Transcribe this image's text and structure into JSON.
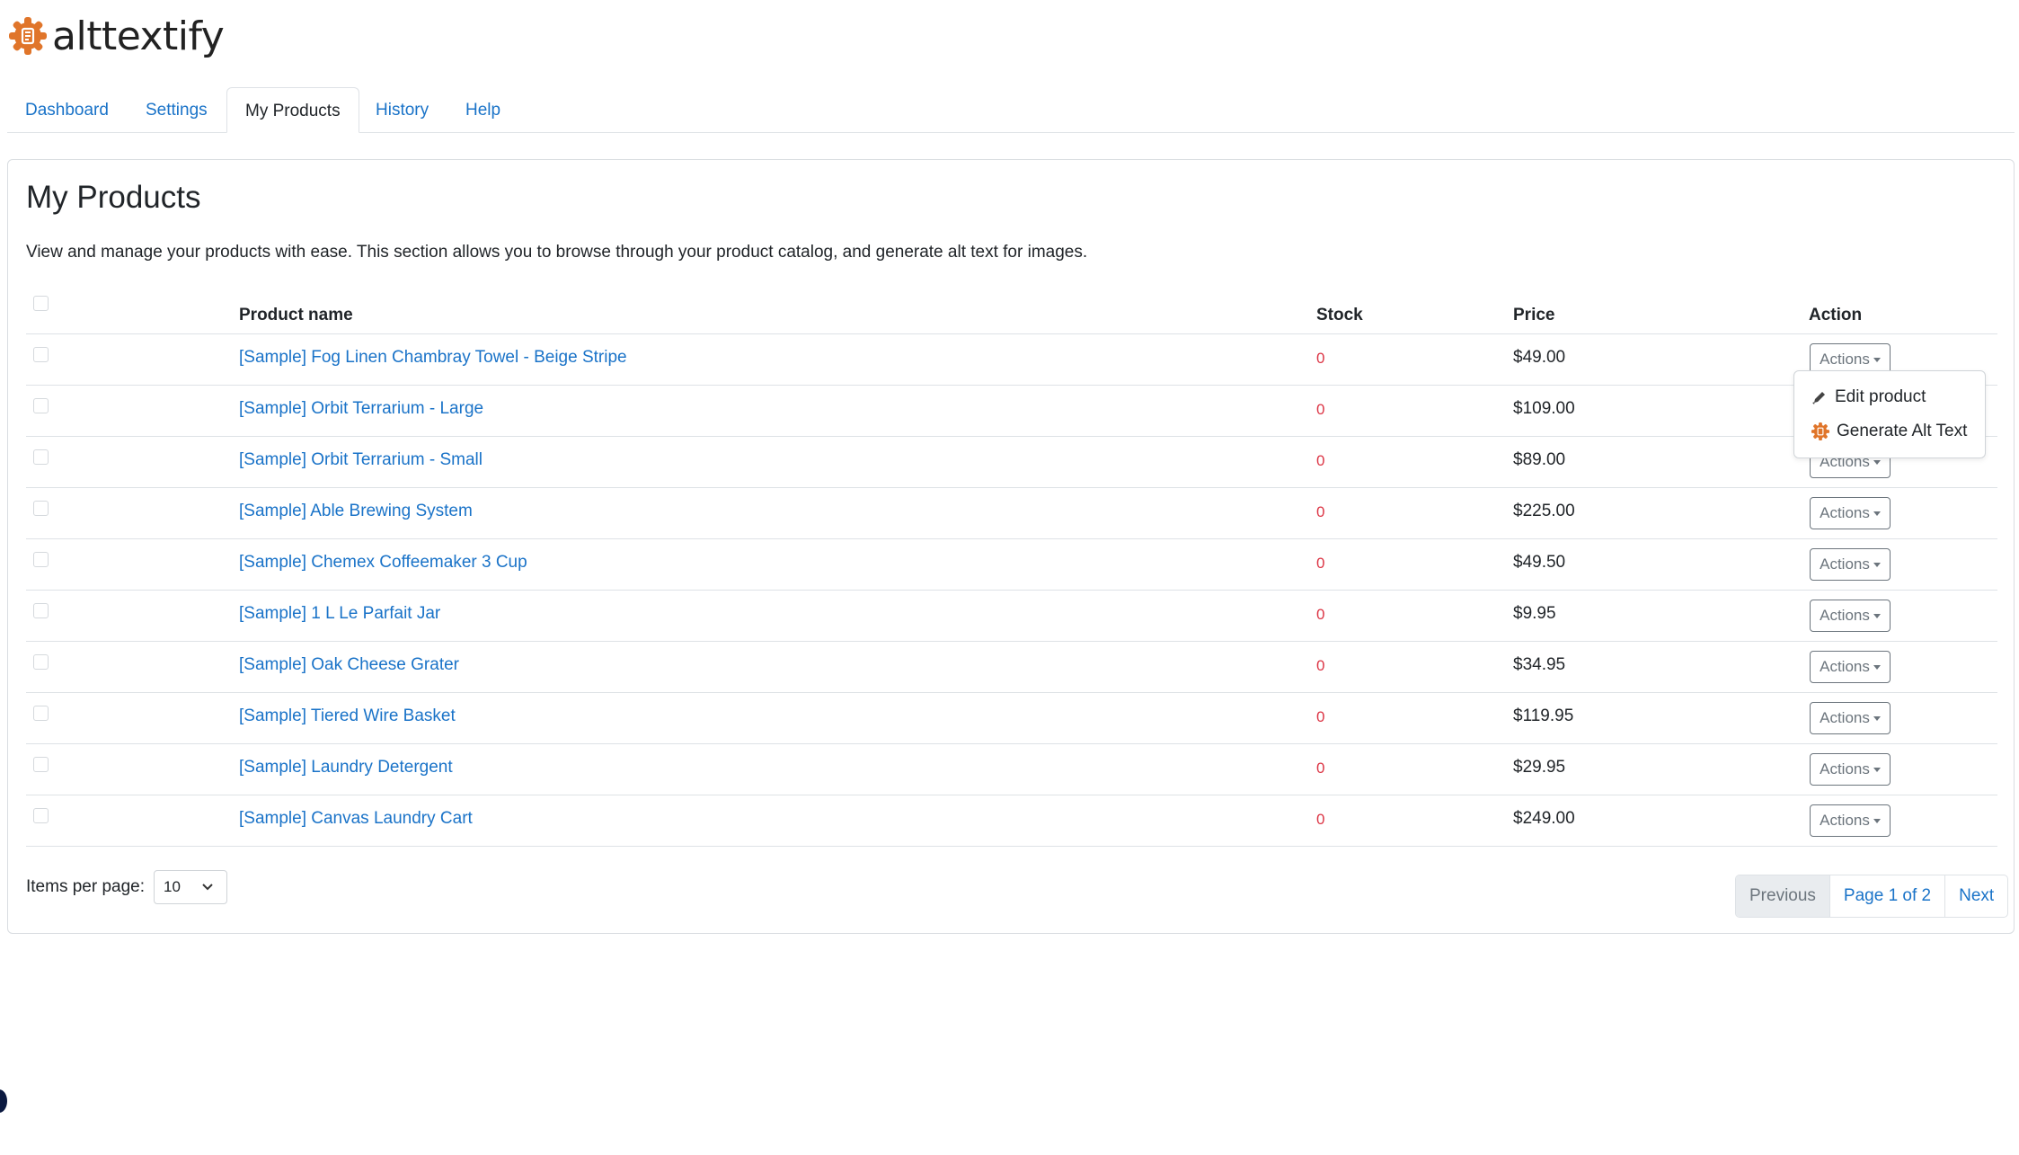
{
  "app": {
    "name": "alttextify",
    "accent": "#e0752a",
    "link_color": "#1a73c8",
    "stock_color": "#dc3545"
  },
  "tabs": [
    {
      "label": "Dashboard",
      "active": false
    },
    {
      "label": "Settings",
      "active": false
    },
    {
      "label": "My Products",
      "active": true
    },
    {
      "label": "History",
      "active": false
    },
    {
      "label": "Help",
      "active": false
    }
  ],
  "page": {
    "title": "My Products",
    "description": "View and manage your products with ease. This section allows you to browse through your product catalog, and generate alt text for images."
  },
  "table": {
    "headers": {
      "name": "Product name",
      "stock": "Stock",
      "price": "Price",
      "action": "Action"
    },
    "action_label": "Actions",
    "rows": [
      {
        "name": "[Sample] Fog Linen Chambray Towel - Beige Stripe",
        "stock": "0",
        "price": "$49.00"
      },
      {
        "name": "[Sample] Orbit Terrarium - Large",
        "stock": "0",
        "price": "$109.00"
      },
      {
        "name": "[Sample] Orbit Terrarium - Small",
        "stock": "0",
        "price": "$89.00"
      },
      {
        "name": "[Sample] Able Brewing System",
        "stock": "0",
        "price": "$225.00"
      },
      {
        "name": "[Sample] Chemex Coffeemaker 3 Cup",
        "stock": "0",
        "price": "$49.50"
      },
      {
        "name": "[Sample] 1 L Le Parfait Jar",
        "stock": "0",
        "price": "$9.95"
      },
      {
        "name": "[Sample] Oak Cheese Grater",
        "stock": "0",
        "price": "$34.95"
      },
      {
        "name": "[Sample] Tiered Wire Basket",
        "stock": "0",
        "price": "$119.95"
      },
      {
        "name": "[Sample] Laundry Detergent",
        "stock": "0",
        "price": "$29.95"
      },
      {
        "name": "[Sample] Canvas Laundry Cart",
        "stock": "0",
        "price": "$249.00"
      }
    ]
  },
  "dropdown": {
    "items": [
      {
        "label": "Edit product",
        "icon": "pencil-icon"
      },
      {
        "label": "Generate Alt Text",
        "icon": "alttextify-gear-icon"
      }
    ]
  },
  "footer": {
    "items_per_page_label": "Items per page:",
    "items_per_page_value": "10",
    "pagination": {
      "previous": "Previous",
      "page_info": "Page 1 of 2",
      "next": "Next"
    }
  }
}
